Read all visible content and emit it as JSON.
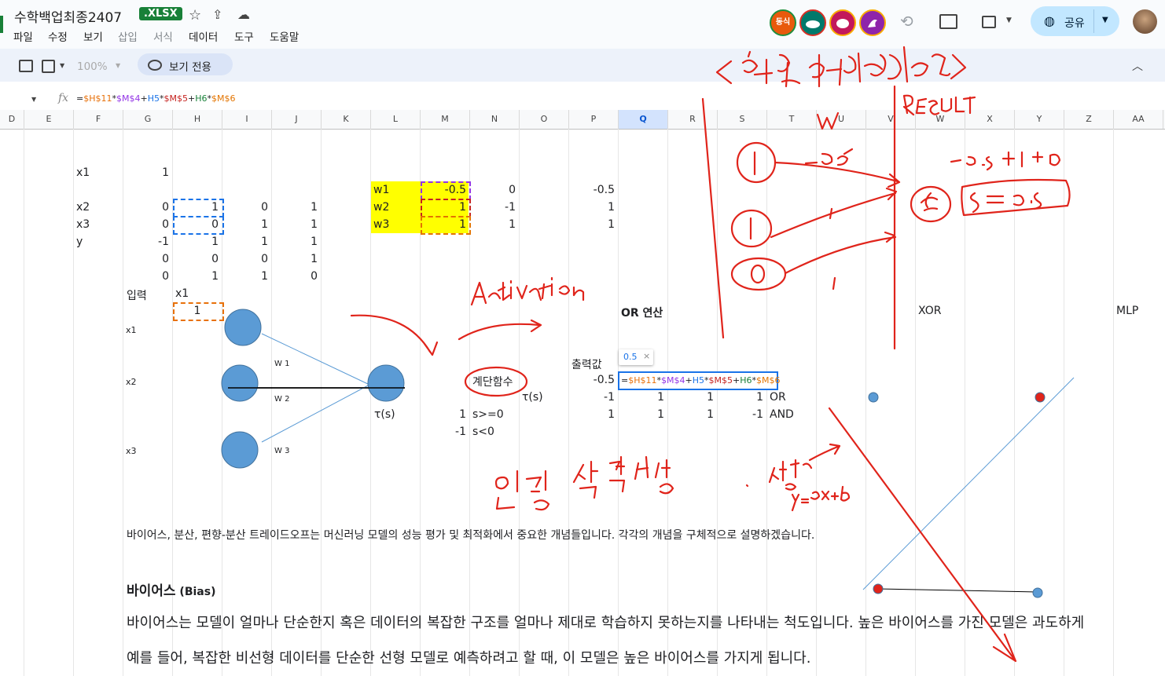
{
  "app": {
    "doc_title": "수학백업최종2407",
    "badge": ".XLSX",
    "menu": [
      "파일",
      "수정",
      "보기",
      "삽입",
      "서식",
      "데이터",
      "도구",
      "도움말"
    ],
    "collab_labels": [
      "동식"
    ],
    "share_label": "공유",
    "zoom": "100%",
    "view_only": "보기 전용"
  },
  "formula_bar": {
    "fx": "fx",
    "parts": [
      "=",
      "$H$11",
      "*",
      "$M$4",
      "+",
      "H5",
      "*",
      "$M$5",
      "+",
      "H6",
      "*",
      "$M$6"
    ]
  },
  "columns": [
    "D",
    "E",
    "F",
    "G",
    "H",
    "I",
    "J",
    "K",
    "L",
    "M",
    "N",
    "O",
    "P",
    "Q",
    "R",
    "S",
    "T",
    "U",
    "V",
    "W",
    "X",
    "Y",
    "Z",
    "AA"
  ],
  "cells": {
    "x1_label": "x1",
    "x1_val": "1",
    "x2_label": "x2",
    "x3_label": "x3",
    "y_label": "y",
    "G5": "0",
    "H5": "1",
    "I5": "0",
    "J5": "1",
    "G6": "0",
    "H6": "0",
    "I6": "1",
    "J6": "1",
    "G7": "-1",
    "H7": "1",
    "I7": "1",
    "J7": "1",
    "G8": "0",
    "H8": "0",
    "I8": "0",
    "J8": "1",
    "G9": "0",
    "H9": "1",
    "I9": "1",
    "J9": "0",
    "w1": "w1",
    "w2": "w2",
    "w3": "w3",
    "M4": "-0.5",
    "M5": "1",
    "M6": "1",
    "N4": "0",
    "N5": "-1",
    "N6": "1",
    "P4": "-0.5",
    "P5": "1",
    "P6": "1",
    "input_label": "입력",
    "input_x1": "x1",
    "input_val": "1",
    "or_label": "OR 연산",
    "xor_label": "XOR",
    "mlp_label": "MLP",
    "output_label": "출력값",
    "output_val": "-0.5",
    "tooltip_val": "0.5",
    "step_fn": "계단함수",
    "tau_s_1": "τ(s)",
    "tau_s_2": "τ(s)",
    "step_1": "1",
    "step_cond_1": "s>=0",
    "step_neg": "-1",
    "step_cond_2": "s<0",
    "row_or": [
      "-1",
      "1",
      "1",
      "1",
      "OR"
    ],
    "row_and": [
      "1",
      "1",
      "1",
      "-1",
      "AND"
    ],
    "nn_x1": "x1",
    "nn_x2": "x2",
    "nn_x3": "x3",
    "nn_w1": "W 1",
    "nn_w2": "W 2",
    "nn_w3": "W 3"
  },
  "text": {
    "intro": "바이어스, 분산, 편향-분산 트레이드오프는 머신러닝 모델의 성능 평가 및 최적화에서 중요한 개념들입니다. 각각의 개념을 구체적으로 설명하겠습니다.",
    "bias_heading_ko": "바이어스",
    "bias_heading_en": " (Bias)",
    "bias_p1": "바이어스는 모델이 얼마나 단순한지 혹은 데이터의 복잡한 구조를 얼마나 제대로 학습하지 못하는지를 나타내는 척도입니다. 높은 바이어스를 가진 모델은 과도하게",
    "bias_p2": "예를 들어, 복잡한 비선형 데이터를 단순한 선형 모델로 예측하려고 할 때, 이 모델은 높은 바이어스를 가지게 됩니다."
  },
  "colors": {
    "ink": "#e0241b",
    "accent": "#1a73e8",
    "neuron": "#5b9bd5",
    "highlight": "#ffff00",
    "ref1": "#e8710a",
    "ref2": "#9334e6",
    "ref3": "#e37400"
  }
}
